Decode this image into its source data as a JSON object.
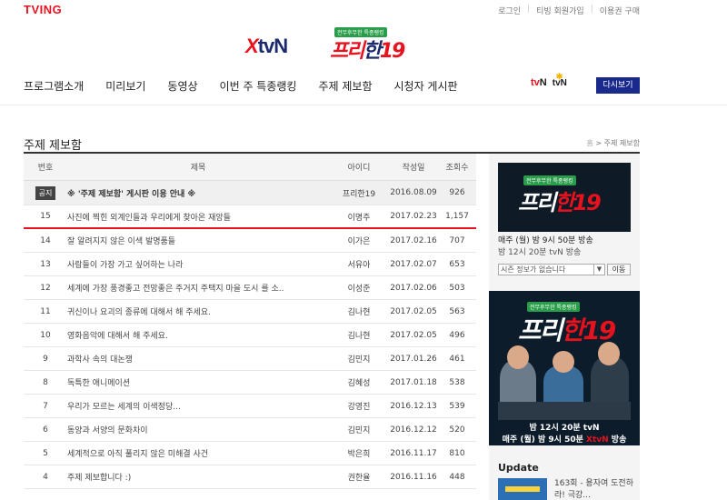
{
  "header": {
    "brand": "TVING",
    "top_links": [
      "로그인",
      "티빙 회원가입",
      "이용권 구매"
    ],
    "channel_logo": {
      "x": "X",
      "tvn": "tvN"
    },
    "show_logo": {
      "tag": "전무후무한 특종랭킹",
      "title_main": "프리",
      "title_k": "한",
      "title_num": "19"
    }
  },
  "nav": {
    "items": [
      "프로그램소개",
      "미리보기",
      "동영상",
      "이번 주 특종랭킹",
      "주제 제보함",
      "시청자 게시판"
    ],
    "small_logo_tvn_r": "tv",
    "small_logo_tvn_n": "N",
    "olive": "tvN",
    "replay_label": "다시보기"
  },
  "page": {
    "title": "주제 제보함",
    "breadcrumb_home": "홈",
    "breadcrumb_sep": ">",
    "breadcrumb_current": "주제 제보함"
  },
  "board": {
    "columns": {
      "num": "번호",
      "title": "제목",
      "author": "아이디",
      "date": "작성일",
      "views": "조회수"
    },
    "notice": {
      "badge": "공지",
      "title": "※ '주제 제보함' 게시판 이용 안내 ※",
      "author": "프리한19",
      "date": "2016.08.09",
      "views": "926"
    },
    "rows": [
      {
        "num": "15",
        "title": "사진에 찍힌 외계인들과 우리에게 찾아온 재앙들",
        "author": "이명주",
        "date": "2017.02.23",
        "views": "1,157"
      },
      {
        "num": "14",
        "title": "잘 알려지지 않은 이색 발명품들",
        "author": "이가은",
        "date": "2017.02.16",
        "views": "707"
      },
      {
        "num": "13",
        "title": "사람들이 가장 가고 싶어하는 나라",
        "author": "서유아",
        "date": "2017.02.07",
        "views": "653"
      },
      {
        "num": "12",
        "title": "세계에 가장 풍경좋고 전망좋은 주거지 주택지 마을 도시 를 소..",
        "author": "이성준",
        "date": "2017.02.06",
        "views": "503"
      },
      {
        "num": "11",
        "title": "귀신이나 요괴의 종류에 대해서 해 주세요.",
        "author": "김나현",
        "date": "2017.02.05",
        "views": "563"
      },
      {
        "num": "10",
        "title": "영화음악에 대해서 해 주세요.",
        "author": "김나현",
        "date": "2017.02.05",
        "views": "496"
      },
      {
        "num": "9",
        "title": "과학사 속의 대논쟁",
        "author": "김민지",
        "date": "2017.01.26",
        "views": "461"
      },
      {
        "num": "8",
        "title": "독특한 애니메이션",
        "author": "김혜성",
        "date": "2017.01.18",
        "views": "538"
      },
      {
        "num": "7",
        "title": "우리가 모르는 세계의 이색정당...",
        "author": "강영진",
        "date": "2016.12.13",
        "views": "539"
      },
      {
        "num": "6",
        "title": "동양과 서양의 문화차이",
        "author": "김민지",
        "date": "2016.12.12",
        "views": "520"
      },
      {
        "num": "5",
        "title": "세계적으로 아직 풀리지 않은 미해결 사건",
        "author": "박은희",
        "date": "2016.11.17",
        "views": "810"
      },
      {
        "num": "4",
        "title": "주제 제보합니다 :)",
        "author": "권한율",
        "date": "2016.11.16",
        "views": "448"
      }
    ]
  },
  "sidebar": {
    "poster1": {
      "tag": "전무후무한 특종랭킹",
      "title_main": "프리",
      "title_k": "한",
      "title_num": "19"
    },
    "schedule_main": "매주 (월) 밤 9시 50분 방송",
    "schedule_sub": "밤 12시 20분 tvN 방송",
    "select_value": "시즌 정보가 없습니다",
    "move_label": "이동",
    "poster2": {
      "tag": "전무후무한 특종랭킹",
      "title_main": "프리",
      "title_k": "한",
      "title_num": "19",
      "time1_pre": "밤 12시 20분 ",
      "time1_ch": "tvN",
      "time2_pre": "매주 (월) 밤 9시 50분 ",
      "time2_ch": "XtvN",
      "time2_post": " 방송"
    },
    "update_title": "Update",
    "update_item": "163회 - 용자여 도전하라! 극강..."
  },
  "colors": {
    "brand_red": "#e8121e",
    "navy": "#1a2a8c",
    "badge_green": "#2a9d4a"
  }
}
